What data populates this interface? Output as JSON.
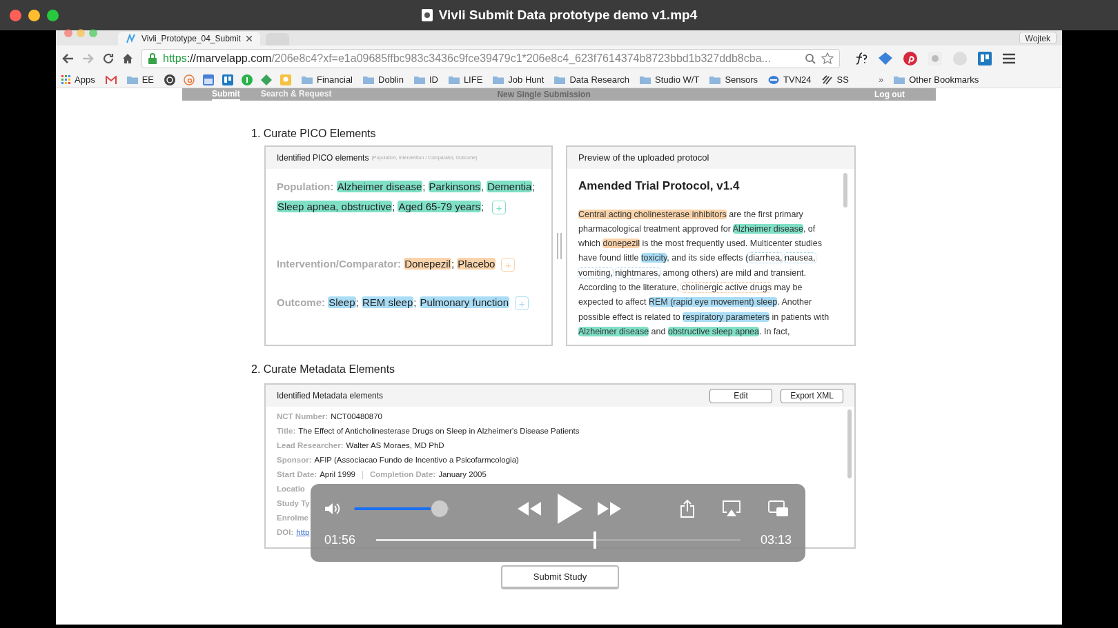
{
  "window": {
    "title": "Vivli Submit Data prototype demo v1.mp4"
  },
  "browser": {
    "tab": {
      "title": "Vivli_Prototype_04_Submit",
      "selected": true
    },
    "user": "Wojtek",
    "url": {
      "scheme": "https",
      "host": "://marvelapp.com",
      "path": "/206e8c4?xf=e1a09685ffbc983c3436c9fce39479c1*206e8c4_623f7614374b8723bbd1b327ddb8cba..."
    },
    "bookmarks": [
      {
        "kind": "apps",
        "label": "Apps"
      },
      {
        "kind": "mail"
      },
      {
        "kind": "folder",
        "label": "EE"
      },
      {
        "kind": "icons"
      },
      {
        "kind": "folder",
        "label": "Financial"
      },
      {
        "kind": "folder",
        "label": "Doblin"
      },
      {
        "kind": "folder",
        "label": "ID"
      },
      {
        "kind": "folder",
        "label": "LIFE"
      },
      {
        "kind": "folder",
        "label": "Job Hunt"
      },
      {
        "kind": "folder",
        "label": "Data Research"
      },
      {
        "kind": "folder",
        "label": "Studio W/T"
      },
      {
        "kind": "folder",
        "label": "Sensors"
      },
      {
        "kind": "site",
        "label": "TVN24"
      },
      {
        "kind": "site2",
        "label": "SS"
      }
    ],
    "more": "»",
    "other": "Other Bookmarks"
  },
  "nav": {
    "items": [
      {
        "label": "Submit",
        "selected": true
      },
      {
        "label": "Search & Request",
        "selected": false
      }
    ],
    "center": "New Single Submission",
    "logout": "Log out"
  },
  "pico": {
    "heading": "1. Curate PICO Elements",
    "panel_title": "Identified PICO elements",
    "panel_hint": "(Population, Intervention / Comparator, Outcome)",
    "groups": [
      {
        "label": "Population:",
        "color": "#7fe0c6",
        "terms": [
          "Alzheimer disease",
          "Parkinsons",
          "Dementia",
          "Sleep apnea, obstructive",
          "Aged 65-79 years"
        ],
        "separators": [
          "; ",
          ", ",
          "; ",
          "; ",
          "; "
        ]
      },
      {
        "label": "Intervention/Comparator:",
        "color": "#fad3aa",
        "terms": [
          "Donepezil",
          "Placebo"
        ],
        "separators": [
          "; "
        ]
      },
      {
        "label": "Outcome:",
        "color": "#a9dcf5",
        "terms": [
          "Sleep",
          "REM sleep",
          "Pulmonary function"
        ],
        "separators": [
          "; ",
          "; "
        ]
      }
    ],
    "add": "+"
  },
  "preview": {
    "panel_title": "Preview of the uploaded protocol",
    "doc_title": "Amended Trial Protocol, v1.4",
    "segments": [
      {
        "kind": "intervention",
        "text": "Central acting cholinesterase inhibitors"
      },
      {
        "kind": "plain",
        "text": " are the first primary pharmacological treatment approved for "
      },
      {
        "kind": "population",
        "text": "Alzheimer disease"
      },
      {
        "kind": "plain",
        "text": ", of which "
      },
      {
        "kind": "intervention",
        "text": "donepezil"
      },
      {
        "kind": "plain",
        "text": " is the most frequently used. Multicenter studies have found little "
      },
      {
        "kind": "outcome",
        "text": "toxicity"
      },
      {
        "kind": "plain",
        "text": ", and its side effects ("
      },
      {
        "kind": "outcome-hint",
        "text": "diarrhea,"
      },
      {
        "kind": "outcome-hint",
        "text": "nausea,"
      },
      {
        "kind": "outcome-hint",
        "text": "vomiting,"
      },
      {
        "kind": "outcome-hint",
        "text": "nightmares,"
      },
      {
        "kind": "plain",
        "text": " among others) are mild and transient. According to the literature, "
      },
      {
        "kind": "intervention-hint",
        "text": "cholinergic active drugs"
      },
      {
        "kind": "plain",
        "text": " may be expected to affect "
      },
      {
        "kind": "outcome",
        "text": "REM (rapid eye movement) sleep"
      },
      {
        "kind": "plain",
        "text": ". Another possible effect is related to "
      },
      {
        "kind": "outcome",
        "text": "respiratory parameters"
      },
      {
        "kind": "plain",
        "text": " in patients with "
      },
      {
        "kind": "population",
        "text": "Alzheimer disease"
      },
      {
        "kind": "plain",
        "text": " and "
      },
      {
        "kind": "population",
        "text": "obstructive sleep apnea"
      },
      {
        "kind": "plain",
        "text": ". In fact,"
      }
    ]
  },
  "metadata": {
    "heading": "2. Curate Metadata Elements",
    "panel_title": "Identified Metadata elements",
    "buttons": [
      "Edit",
      "Export XML"
    ],
    "rows": [
      {
        "fields": [
          {
            "label": "NCT Number:",
            "value": "NCT00480870"
          }
        ]
      },
      {
        "fields": [
          {
            "label": "Title:",
            "value": "The Effect of Anticholinesterase Drugs on Sleep in Alzheimer's Disease Patients"
          }
        ]
      },
      {
        "fields": [
          {
            "label": "Lead Researcher:",
            "value": "Walter AS Moraes, MD PhD"
          }
        ]
      },
      {
        "fields": [
          {
            "label": "Sponsor:",
            "value": "AFIP (Associacao Fundo de Incentivo a Psicofarmcologia)"
          }
        ]
      },
      {
        "fields": [
          {
            "label": "Start Date:",
            "value": "April 1999"
          },
          {
            "label": "Completion Date:",
            "value": "January 2005"
          }
        ]
      },
      {
        "fields": [
          {
            "label": "Locatio"
          }
        ]
      },
      {
        "fields": [
          {
            "label": "Study Ty"
          }
        ]
      },
      {
        "fields": [
          {
            "label": "Enrolme"
          }
        ]
      },
      {
        "fields": [
          {
            "label": "DOI:",
            "link": "http"
          }
        ]
      }
    ]
  },
  "submit": "Submit Study",
  "player": {
    "volume": {
      "level": 0.9
    },
    "progress": {
      "level": 0.6
    },
    "elapsed": "01:56",
    "total": "03:13",
    "playing": false
  }
}
